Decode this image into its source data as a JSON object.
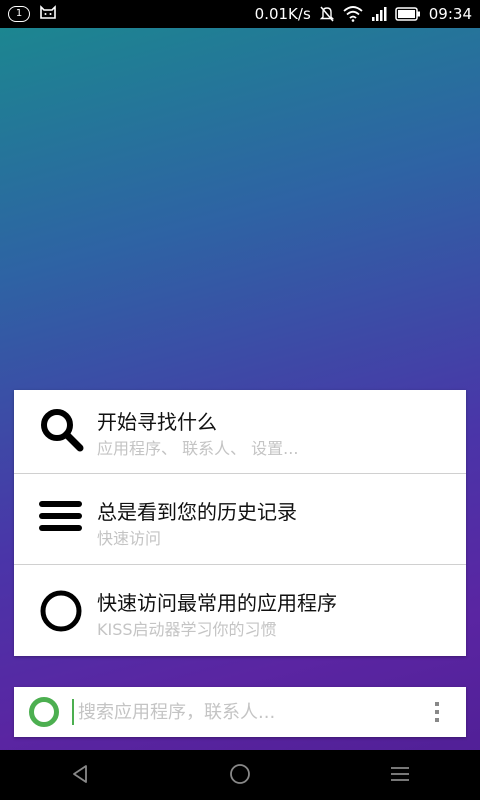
{
  "status_bar": {
    "notification_badge": "1",
    "net_speed": "0.01K/s",
    "time": "09:34",
    "icons": [
      "notification-count-icon",
      "cat-icon",
      "mute-icon",
      "wifi-icon",
      "signal-icon",
      "battery-icon"
    ]
  },
  "hints": [
    {
      "icon": "search-icon",
      "title": "开始寻找什么",
      "subtitle": "应用程序、 联系人、 设置..."
    },
    {
      "icon": "menu-icon",
      "title": "总是看到您的历史记录",
      "subtitle": "快速访问"
    },
    {
      "icon": "circle-icon",
      "title": "快速访问最常用的应用程序",
      "subtitle": "KISS启动器学习你的习惯"
    }
  ],
  "search": {
    "placeholder": "搜索应用程序，联系人...",
    "value": ""
  },
  "nav_bar": {
    "buttons": [
      "back-icon",
      "home-icon",
      "menu-icon"
    ]
  },
  "colors": {
    "accent": "#4caf50",
    "bg_top": "#1a8a8e",
    "bg_bottom": "#4e1e93"
  }
}
